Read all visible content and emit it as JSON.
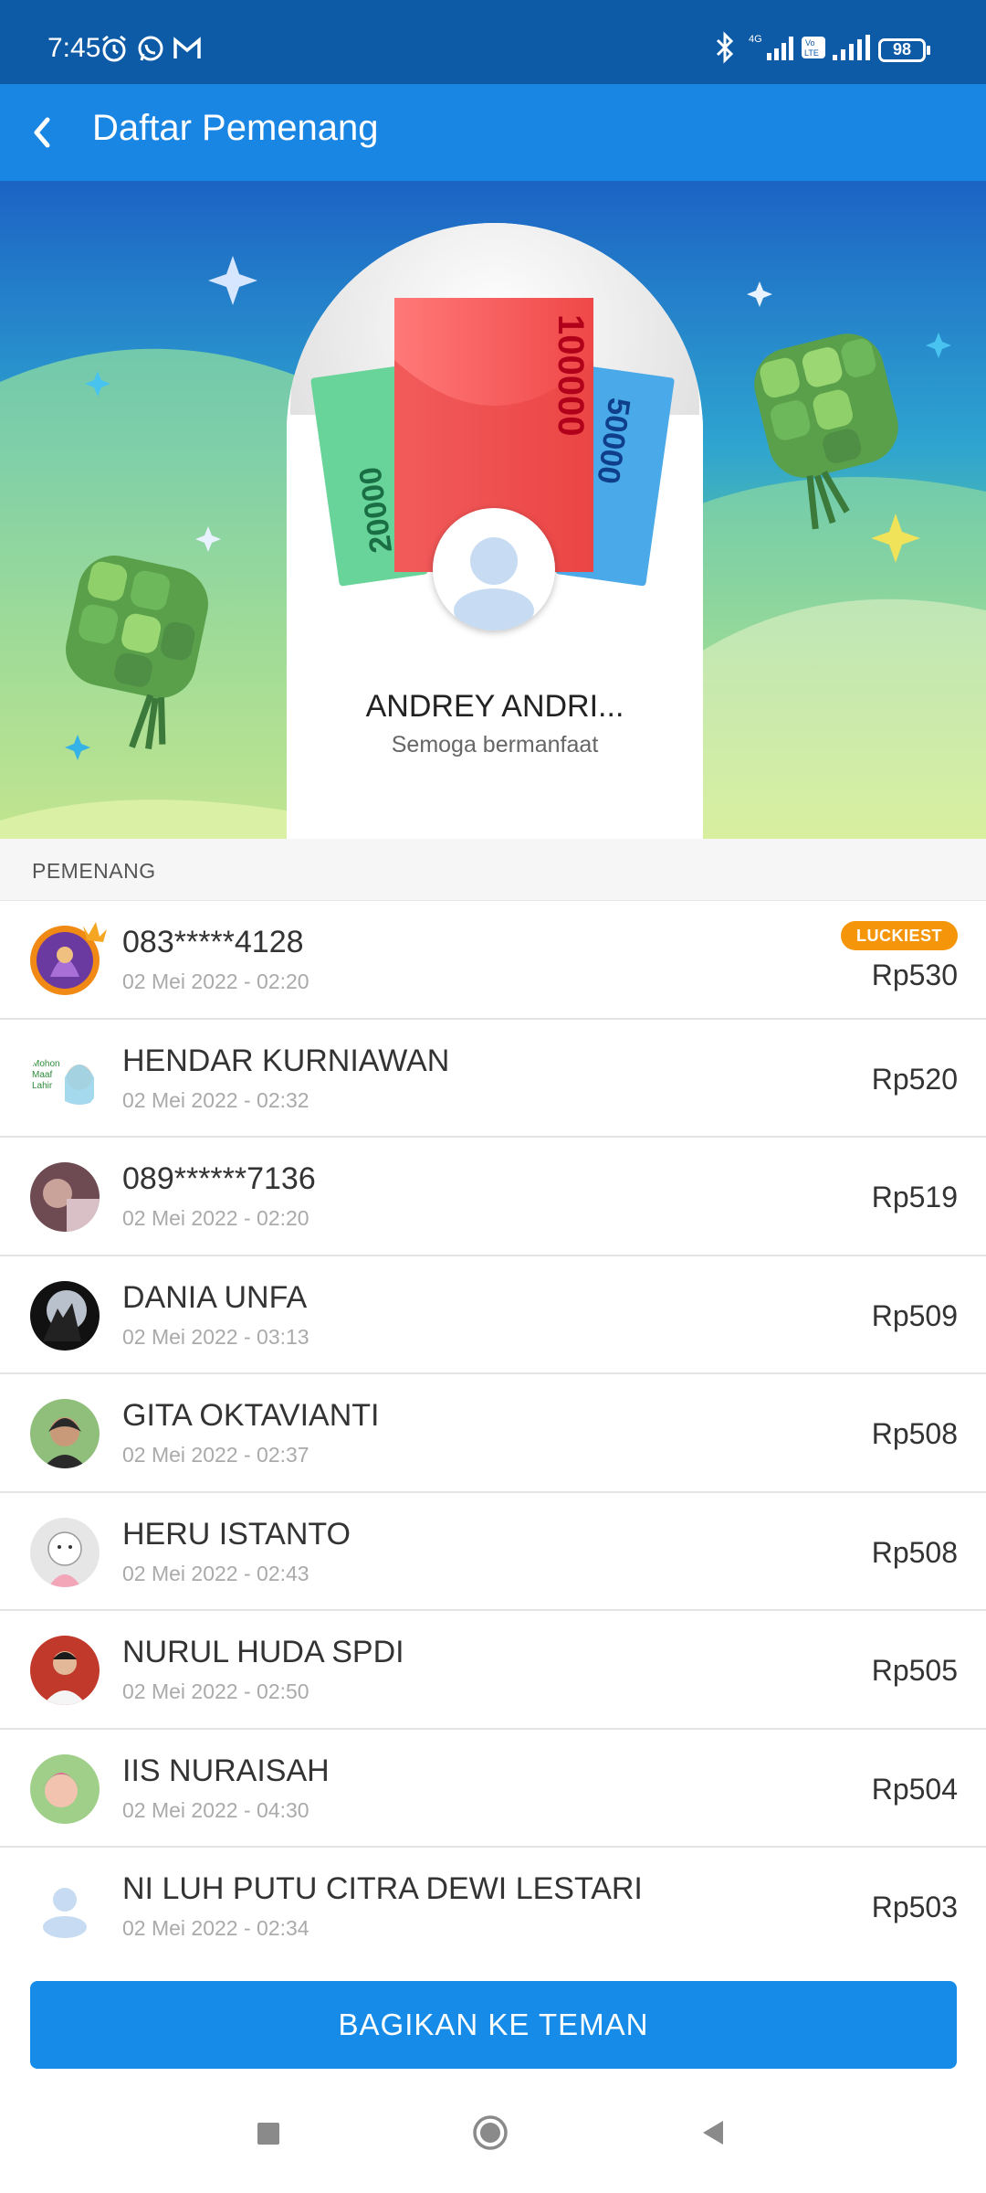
{
  "status_bar": {
    "time": "7:45",
    "battery": "98"
  },
  "header": {
    "title": "Daftar Pemenang"
  },
  "hero": {
    "notes": [
      "20000",
      "100000",
      "50000"
    ],
    "winner_name": "ANDREY ANDRI...",
    "winner_message": "Semoga bermanfaat"
  },
  "list": {
    "section_label": "PEMENANG",
    "badge_label": "LUCKIEST",
    "winners": [
      {
        "name": "083*****4128",
        "date": "02 Mei 2022 - 02:20",
        "amount": "Rp530",
        "avatar": "purple-crown-avatar"
      },
      {
        "name": "HENDAR KURNIAWAN",
        "date": "02 Mei 2022 - 02:32",
        "amount": "Rp520",
        "avatar": "sticker-avatar"
      },
      {
        "name": "089******7136",
        "date": "02 Mei 2022 - 02:20",
        "amount": "Rp519",
        "avatar": "photo-avatar"
      },
      {
        "name": "DANIA UNFA",
        "date": "02 Mei 2022 - 03:13",
        "amount": "Rp509",
        "avatar": "wolf-avatar"
      },
      {
        "name": "GITA OKTAVIANTI",
        "date": "02 Mei 2022 - 02:37",
        "amount": "Rp508",
        "avatar": "photo-avatar"
      },
      {
        "name": "HERU ISTANTO",
        "date": "02 Mei 2022 - 02:43",
        "amount": "Rp508",
        "avatar": "cartoon-avatar"
      },
      {
        "name": "NURUL HUDA SPDI",
        "date": "02 Mei 2022 - 02:50",
        "amount": "Rp505",
        "avatar": "photo-avatar"
      },
      {
        "name": "IIS NURAISAH",
        "date": "02 Mei 2022 - 04:30",
        "amount": "Rp504",
        "avatar": "photo-avatar"
      },
      {
        "name": "NI LUH PUTU CITRA DEWI LESTARI",
        "date": "02 Mei 2022 - 02:34",
        "amount": "Rp503",
        "avatar": "default-avatar"
      }
    ]
  },
  "footer": {
    "share_label": "BAGIKAN KE TEMAN"
  },
  "colors": {
    "app_bar": "#1a86e3",
    "status_bar": "#0d5aa6",
    "button": "#168be8",
    "badge": "#f5960a"
  }
}
